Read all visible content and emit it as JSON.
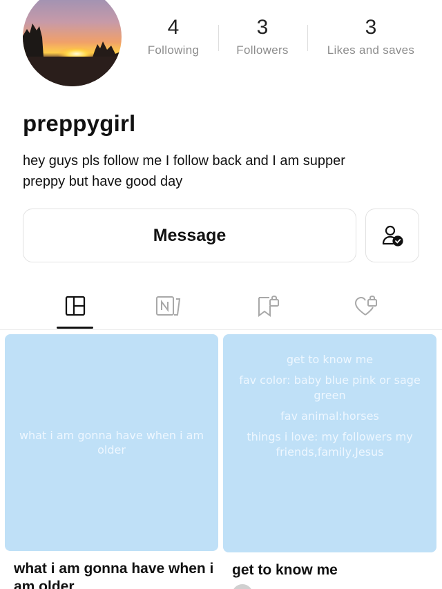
{
  "profile": {
    "username": "preppygirl",
    "bio_line1": "hey guys pls follow me I follow back and I am supper",
    "bio_line2": "preppy but  have good day"
  },
  "stats": {
    "following_count": "4",
    "following_label": "Following",
    "followers_count": "3",
    "followers_label": "Followers",
    "likes_count": "3",
    "likes_label": "Likes and saves"
  },
  "actions": {
    "message_label": "Message",
    "follow_icon": "user-check-icon"
  },
  "tabs": [
    {
      "icon": "grid-icon",
      "selected": true
    },
    {
      "icon": "notes-icon",
      "selected": false
    },
    {
      "icon": "bookmark-lock-icon",
      "selected": false
    },
    {
      "icon": "heart-lock-icon",
      "selected": false
    }
  ],
  "posts": [
    {
      "cover_text": "what i am gonna have when i am older",
      "title": "what i am gonna have when i am older"
    },
    {
      "cover_lines": [
        "get to know me",
        "fav color: baby blue pink or sage green",
        "fav animal:horses",
        "things i love: my followers my friends,family,Jesus"
      ],
      "title": "get to know me"
    }
  ],
  "colors": {
    "card_bg": "#bfe0f7",
    "text": "#111111",
    "muted": "#8c8c8c"
  }
}
